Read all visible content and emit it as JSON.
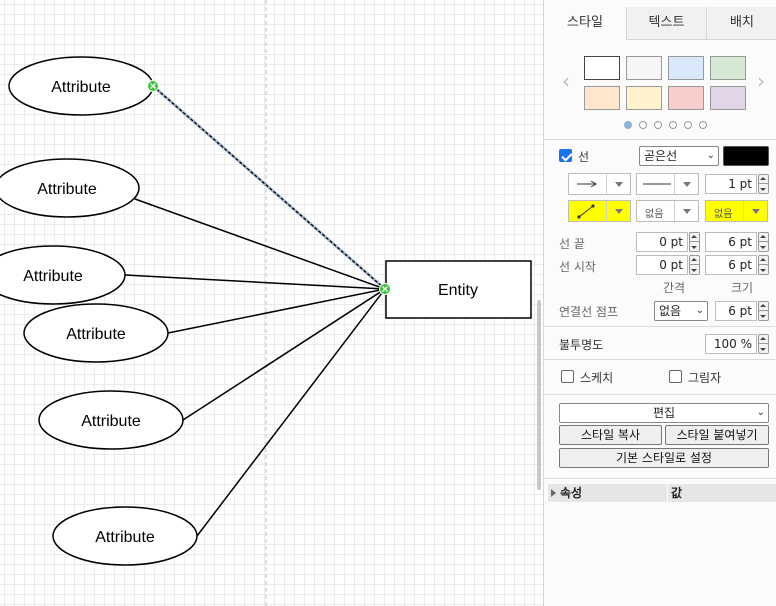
{
  "diagram": {
    "attributes": [
      "Attribute",
      "Attribute",
      "Attribute",
      "Attribute",
      "Attribute",
      "Attribute"
    ],
    "entity": "Entity"
  },
  "panel": {
    "tabs": [
      "스타일",
      "텍스트",
      "배치"
    ],
    "swatches": [
      "#ffffff",
      "#f5f5f5",
      "#dae8fc",
      "#d5e8d4",
      "#ffe6cc",
      "#fff2cc",
      "#f8cecc",
      "#e1d5e7"
    ],
    "line": {
      "label": "선",
      "checked": true,
      "type": "곧은선",
      "color": "#000000",
      "width": "1 pt",
      "waypoint_none": "없음",
      "line_end_none": "없음"
    },
    "line_end": {
      "label": "선 끝",
      "spacing": "0 pt",
      "size": "6 pt"
    },
    "line_start": {
      "label": "선 시작",
      "spacing": "0 pt",
      "size": "6 pt"
    },
    "col_labels": {
      "spacing": "간격",
      "size": "크기"
    },
    "jump": {
      "label": "연결선 점프",
      "value": "없음",
      "size": "6 pt"
    },
    "opacity": {
      "label": "불투명도",
      "value": "100 %"
    },
    "sketch": {
      "label": "스케치",
      "checked": false
    },
    "shadow": {
      "label": "그림자",
      "checked": false
    },
    "edit_select": "편집",
    "copy_style": "스타일 복사",
    "paste_style": "스타일 붙여넣기",
    "set_default": "기본 스타일로 설정",
    "props": {
      "col1": "속성",
      "col2": "값"
    }
  }
}
